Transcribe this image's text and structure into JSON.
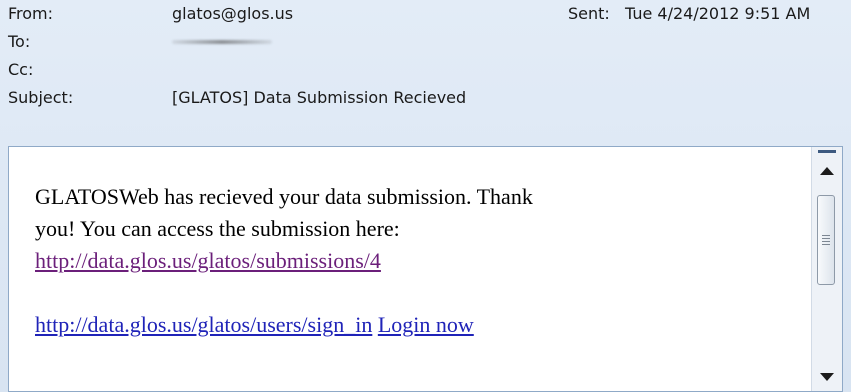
{
  "header": {
    "from_label": "From:",
    "from_value": "glatos@glos.us",
    "sent_label": "Sent:",
    "sent_value": "Tue 4/24/2012 9:51 AM",
    "to_label": "To:",
    "cc_label": "Cc:",
    "subject_label": "Subject:",
    "subject_value": "[GLATOS] Data Submission Recieved"
  },
  "body": {
    "line1": "GLATOSWeb has recieved your data submission. Thank",
    "line2": "you! You can access the submission here:",
    "submission_link": "http://data.glos.us/glatos/submissions/4",
    "signin_link": "http://data.glos.us/glatos/users/sign_in",
    "login_link": "Login now"
  },
  "colors": {
    "header_background": "#dfe9f5",
    "visited_link": "#6b1f7a",
    "link": "#1f23b8"
  },
  "icons": {
    "scroll_up": "triangle-up",
    "scroll_down": "triangle-down",
    "thumb_grip": "grip-lines"
  }
}
